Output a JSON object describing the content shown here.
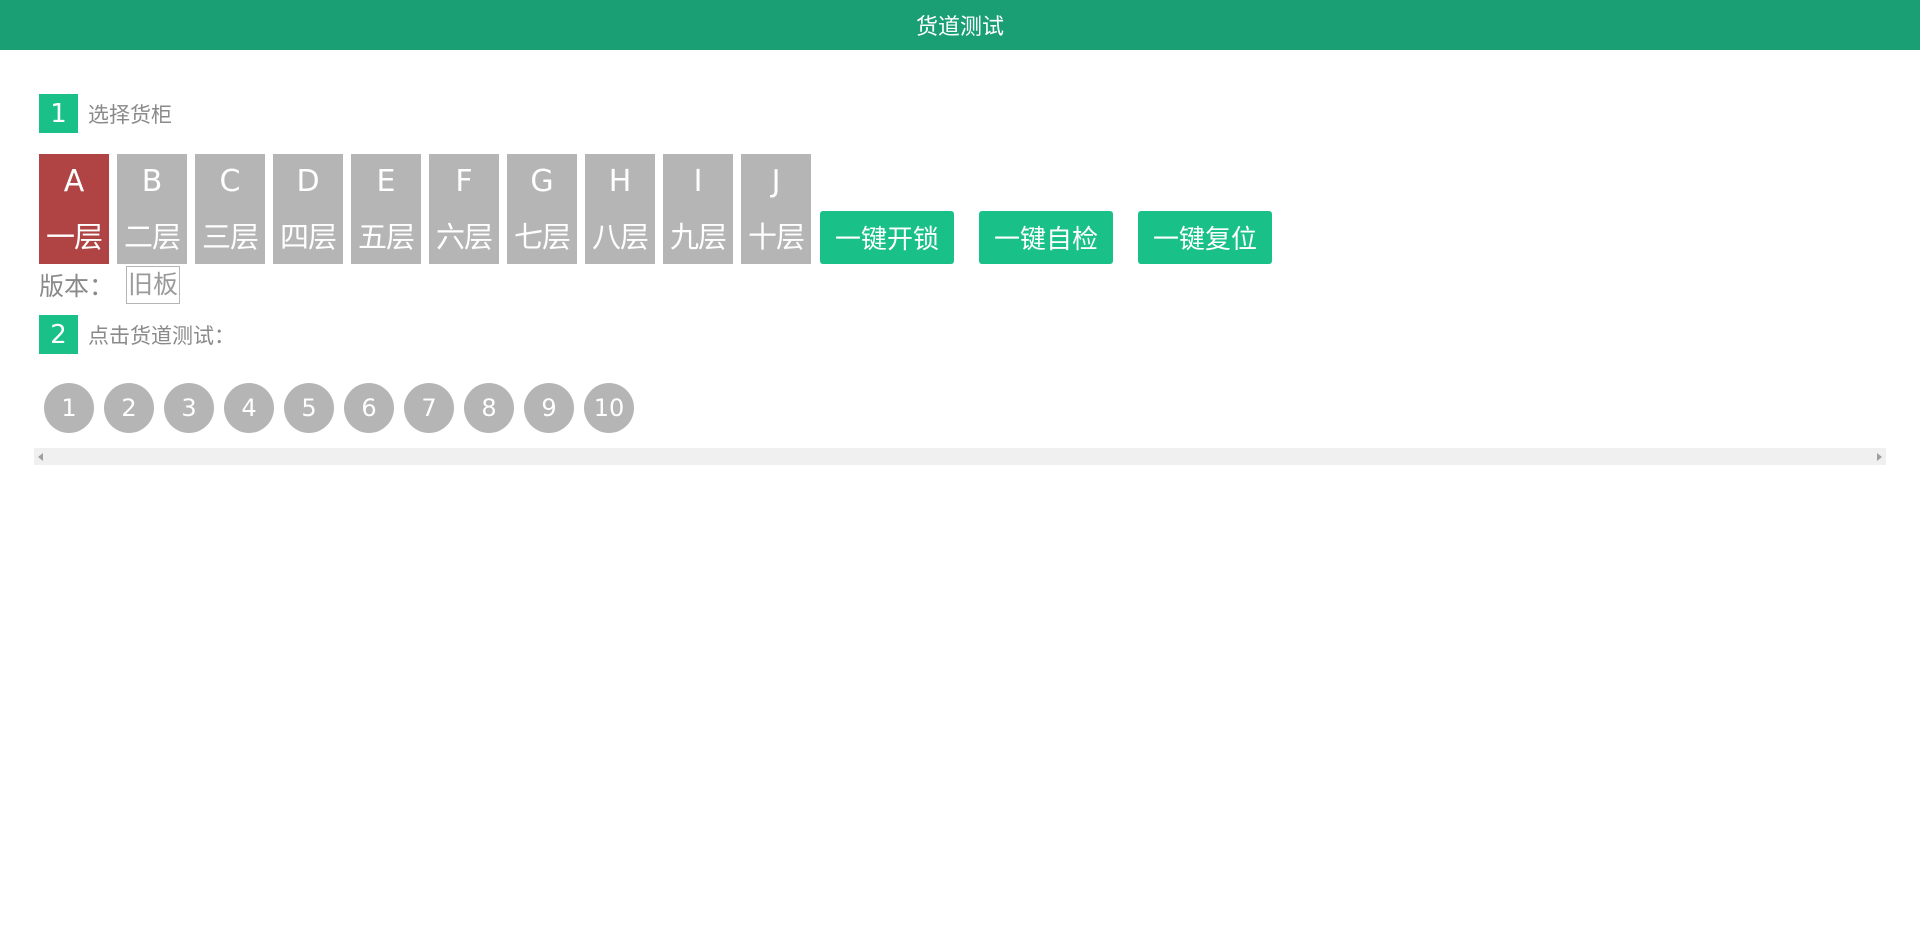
{
  "header": {
    "title": "货道测试"
  },
  "step1": {
    "number": "1",
    "label": "选择货柜"
  },
  "cabinets": [
    {
      "letter": "A",
      "layer": "一层",
      "selected": true
    },
    {
      "letter": "B",
      "layer": "二层",
      "selected": false
    },
    {
      "letter": "C",
      "layer": "三层",
      "selected": false
    },
    {
      "letter": "D",
      "layer": "四层",
      "selected": false
    },
    {
      "letter": "E",
      "layer": "五层",
      "selected": false
    },
    {
      "letter": "F",
      "layer": "六层",
      "selected": false
    },
    {
      "letter": "G",
      "layer": "七层",
      "selected": false
    },
    {
      "letter": "H",
      "layer": "八层",
      "selected": false
    },
    {
      "letter": "I",
      "layer": "九层",
      "selected": false
    },
    {
      "letter": "J",
      "layer": "十层",
      "selected": false
    }
  ],
  "actions": {
    "unlock_all": "一键开锁",
    "self_check": "一键自检",
    "reset": "一键复位"
  },
  "version": {
    "label": "版本：",
    "value": "旧板"
  },
  "step2": {
    "number": "2",
    "label": "点击货道测试："
  },
  "lanes": [
    "1",
    "2",
    "3",
    "4",
    "5",
    "6",
    "7",
    "8",
    "9",
    "10"
  ],
  "colors": {
    "header_bg": "#1a9e74",
    "accent": "#19c088",
    "selected": "#b04444",
    "inactive": "#b5b5b5"
  },
  "icons": {
    "scroll_left": "scroll-left-arrow-icon",
    "scroll_right": "scroll-right-arrow-icon"
  }
}
